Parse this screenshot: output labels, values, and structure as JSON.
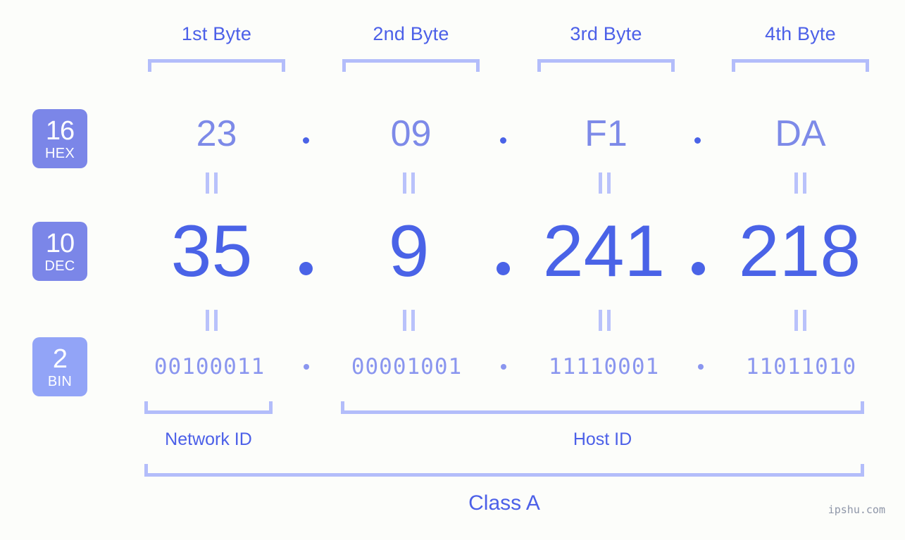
{
  "background_color": "#fcfdfa",
  "colors": {
    "header_blue": "#4c60e8",
    "hex_value_blue": "#7d8ae8",
    "dec_value_blue": "#4a63e7",
    "bin_value_blue": "#8a96ef",
    "bracket_blue": "#b3bdfa",
    "badge_blue": "#7b86e8",
    "badge_blue_light": "#92a4f7",
    "watermark_gray": "#8e96a8"
  },
  "byte_headers": [
    {
      "label": "1st Byte"
    },
    {
      "label": "2nd Byte"
    },
    {
      "label": "3rd Byte"
    },
    {
      "label": "4th Byte"
    }
  ],
  "badges": [
    {
      "num": "16",
      "abbr": "HEX"
    },
    {
      "num": "10",
      "abbr": "DEC"
    },
    {
      "num": "2",
      "abbr": "BIN"
    }
  ],
  "rows": {
    "hex": {
      "values": [
        "23",
        "09",
        "F1",
        "DA"
      ],
      "separator": "."
    },
    "dec": {
      "values": [
        "35",
        "9",
        "241",
        "218"
      ],
      "separator": "."
    },
    "bin": {
      "values": [
        "00100011",
        "00001001",
        "11110001",
        "11011010"
      ],
      "separator": "."
    }
  },
  "equality_marks": {
    "upper": [
      "=",
      "=",
      "=",
      "="
    ],
    "lower": [
      "=",
      "=",
      "=",
      "="
    ]
  },
  "segments": {
    "network_id": "Network ID",
    "host_id": "Host ID"
  },
  "class": {
    "label": "Class A"
  },
  "watermark": "ipshu.com"
}
